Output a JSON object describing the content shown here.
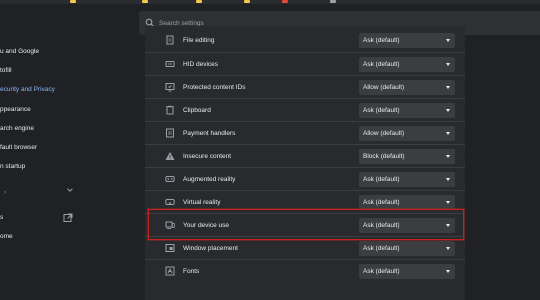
{
  "sidebar": {
    "items": [
      {
        "label": "u and Google",
        "icon": "person-icon"
      },
      {
        "label": "tofill",
        "icon": "autofill-icon"
      },
      {
        "label": "ecurity and Privacy",
        "icon": "shield-icon",
        "active": true
      },
      {
        "label": "ppearance",
        "icon": "palette-icon"
      },
      {
        "label": "arch engine",
        "icon": "search-icon"
      },
      {
        "label": "fault browser",
        "icon": "browser-icon"
      },
      {
        "label": "n startup",
        "icon": "power-icon"
      },
      {
        "label": "s",
        "icon": "extensions-icon"
      },
      {
        "label": "ome",
        "icon": "chrome-icon"
      }
    ],
    "accent": "#8ab4f8"
  },
  "search": {
    "placeholder": "Search settings"
  },
  "permissions": [
    {
      "label": "File editing",
      "value": "Ask (default)",
      "icon": "file-edit-icon"
    },
    {
      "label": "HID devices",
      "value": "Ask (default)",
      "icon": "hid-device-icon"
    },
    {
      "label": "Protected content IDs",
      "value": "Allow (default)",
      "icon": "protected-content-icon"
    },
    {
      "label": "Clipboard",
      "value": "Ask (default)",
      "icon": "clipboard-icon"
    },
    {
      "label": "Payment handlers",
      "value": "Allow (default)",
      "icon": "payment-handler-icon"
    },
    {
      "label": "Insecure content",
      "value": "Block (default)",
      "icon": "warning-icon"
    },
    {
      "label": "Augmented reality",
      "value": "Ask (default)",
      "icon": "augmented-reality-icon"
    },
    {
      "label": "Virtual reality",
      "value": "Ask (default)",
      "icon": "vr-headset-icon"
    },
    {
      "label": "Your device use",
      "value": "Ask (default)",
      "icon": "device-use-icon"
    },
    {
      "label": "Window placement",
      "value": "Ask (default)",
      "icon": "window-placement-icon"
    },
    {
      "label": "Fonts",
      "value": "Ask (default)",
      "icon": "font-icon"
    }
  ],
  "highlight_color": "#c5221f"
}
